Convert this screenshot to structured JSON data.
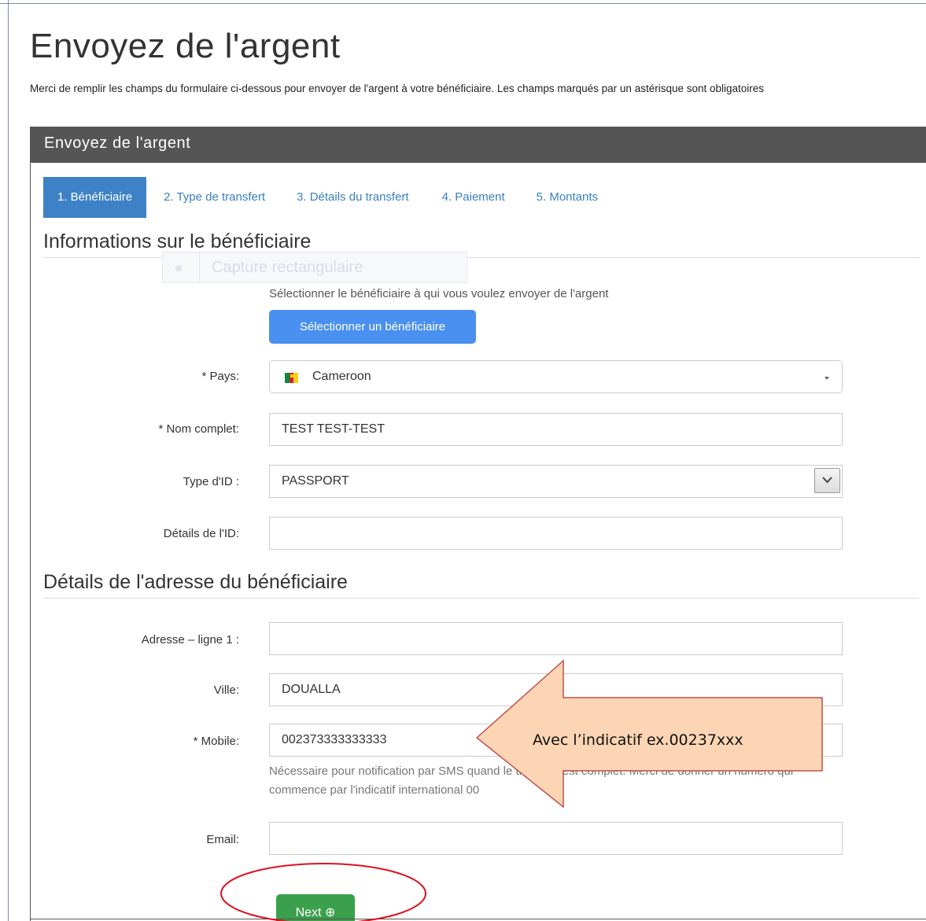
{
  "header": {
    "title": "Envoyez de l'argent",
    "intro": "Merci de remplir les champs du formulaire ci-dessous pour envoyer de l'argent à votre bénéficiaire. Les champs marqués par un astérisque sont obligatoires"
  },
  "panel": {
    "title": "Envoyez de l'argent"
  },
  "tabs": [
    {
      "label": "1. Bénéficiaire",
      "active": true
    },
    {
      "label": "2. Type de transfert",
      "active": false
    },
    {
      "label": "3. Détails du transfert",
      "active": false
    },
    {
      "label": "4. Paiement",
      "active": false
    },
    {
      "label": "5. Montants",
      "active": false
    }
  ],
  "beneficiary": {
    "section_title": "Informations sur le bénéficiaire",
    "ghost_label": "Capture rectangulaire",
    "helper": "Sélectionner le bénéficiaire à qui vous voulez envoyer de l'argent",
    "select_button": "Sélectionner un bénéficiaire",
    "fields": {
      "pays": {
        "label": "* Pays:",
        "value": "Cameroon"
      },
      "nom": {
        "label": "* Nom complet:",
        "value": "TEST TEST-TEST"
      },
      "type_id": {
        "label": "Type d'ID :",
        "value": "PASSPORT"
      },
      "details_id": {
        "label": "Détails de l'ID:",
        "value": ""
      }
    }
  },
  "address": {
    "section_title": "Détails de l'adresse du bénéficiaire",
    "fields": {
      "adresse": {
        "label": "Adresse – ligne 1 :",
        "value": ""
      },
      "ville": {
        "label": "Ville:",
        "value": "DOUALLA"
      },
      "mobile": {
        "label": "* Mobile:",
        "value": "002373333333333"
      },
      "email": {
        "label": "Email:",
        "value": ""
      }
    },
    "mobile_help": "Nécessaire pour notification par SMS quand le transfert est complet. Merci de donner un numéro qui commence par l'indicatif international 00"
  },
  "actions": {
    "next_label": "Next ⊕"
  },
  "annotation": {
    "arrow_text": "Avec l’indicatif ex.00237xxx",
    "arrow_color": "#fcd5b4",
    "arrow_border": "#c0504d",
    "circle_color": "#e0101e"
  },
  "colors": {
    "tab_active": "#3d82c6",
    "select_button": "#4a90f0",
    "next_button": "#3aa04c",
    "panel_header": "#555555"
  }
}
